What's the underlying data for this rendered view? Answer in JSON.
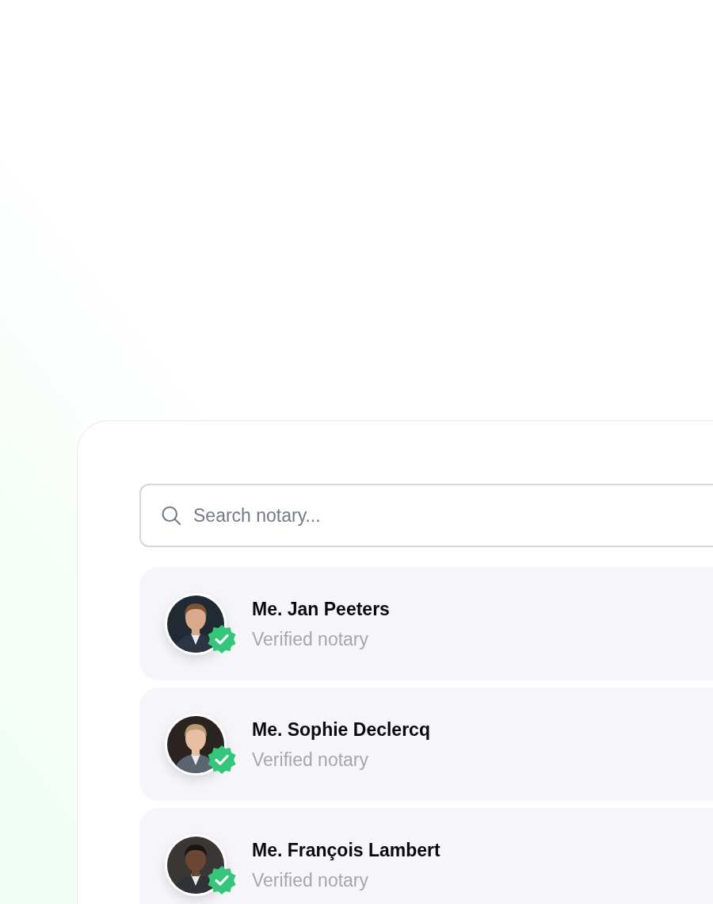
{
  "search": {
    "placeholder": "Search notary..."
  },
  "notaries": [
    {
      "name": "Me. Jan Peeters",
      "subtitle": "Verified notary",
      "verified": true,
      "kind": "picture"
    },
    {
      "name": "Me. Sophie Declercq",
      "subtitle": "Verified notary",
      "verified": true,
      "kind": "picture"
    },
    {
      "name": "Me. François Lambert",
      "subtitle": "Verified notary",
      "verified": true,
      "kind": "picture"
    }
  ]
}
